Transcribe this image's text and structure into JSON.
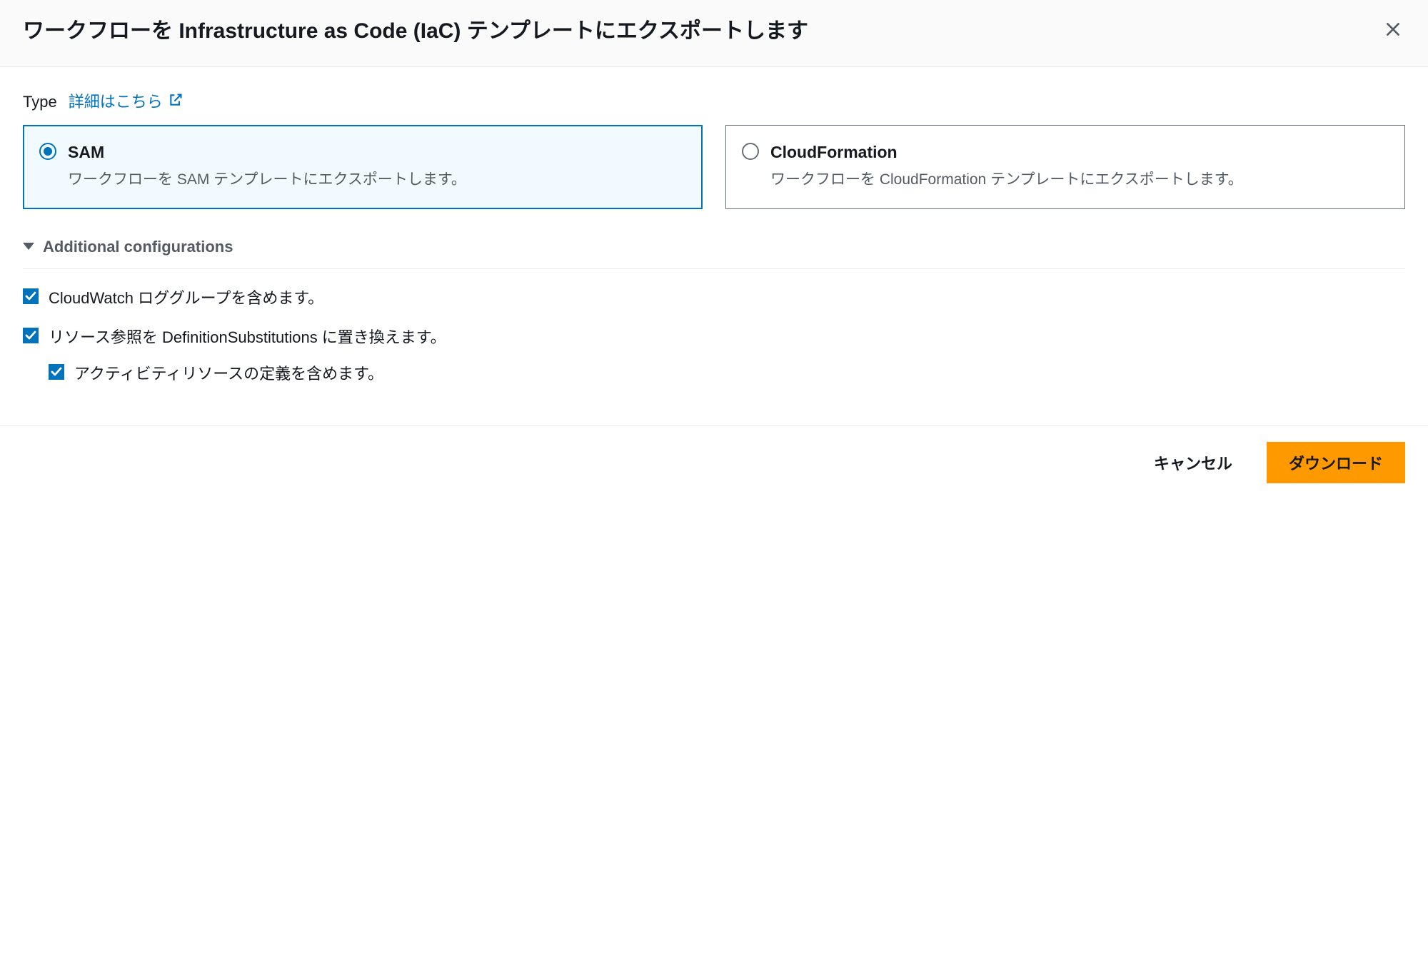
{
  "header": {
    "title": "ワークフローを Infrastructure as Code (IaC) テンプレートにエクスポートします"
  },
  "type_section": {
    "label": "Type",
    "learn_more": "詳細はこちら",
    "options": [
      {
        "title": "SAM",
        "description": "ワークフローを SAM テンプレートにエクスポートします。",
        "selected": true
      },
      {
        "title": "CloudFormation",
        "description": "ワークフローを CloudFormation テンプレートにエクスポートします。",
        "selected": false
      }
    ]
  },
  "additional": {
    "header": "Additional configurations",
    "items": [
      {
        "label": "CloudWatch ロググループを含めます。",
        "checked": true
      },
      {
        "label": "リソース参照を DefinitionSubstitutions に置き換えます。",
        "checked": true
      },
      {
        "label": "アクティビティリソースの定義を含めます。",
        "checked": true,
        "indent": true
      }
    ]
  },
  "footer": {
    "cancel": "キャンセル",
    "download": "ダウンロード"
  }
}
